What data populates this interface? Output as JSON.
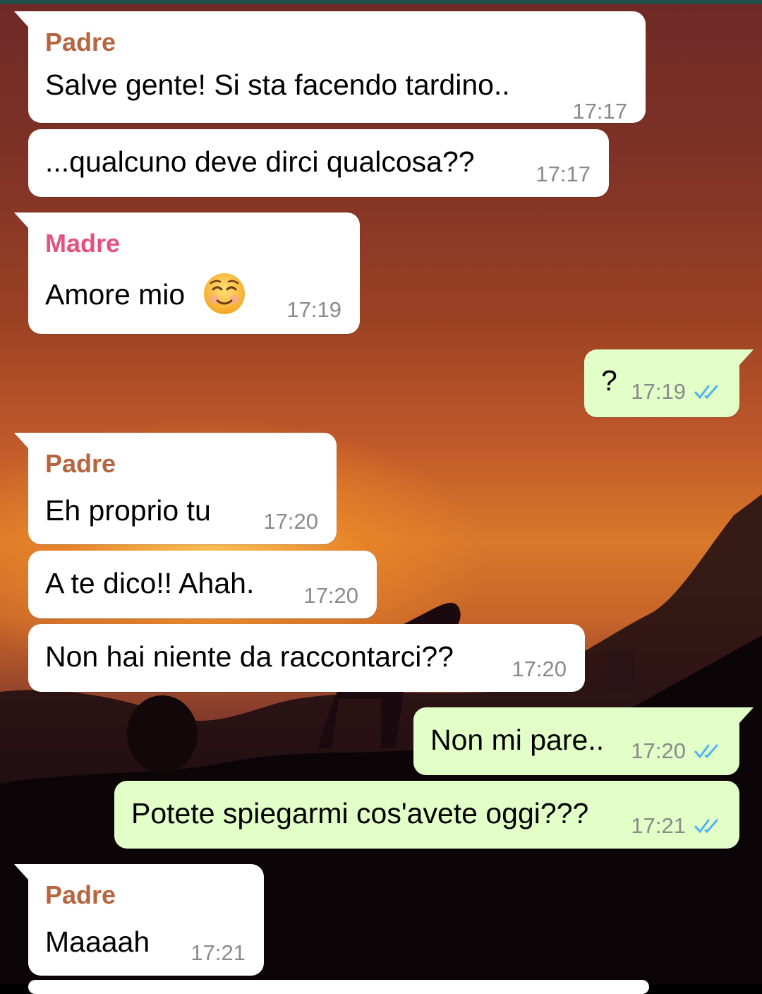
{
  "colors": {
    "incoming_bubble": "#ffffff",
    "outgoing_bubble": "#e1ffc7",
    "padre_name": "#b5653f",
    "madre_name": "#e5517f",
    "timestamp": "#8a8a8a",
    "read_ticks": "#4fb3f0"
  },
  "messages": [
    {
      "direction": "in",
      "sender": "Padre",
      "text": "Salve gente! Si sta facendo tardino..",
      "time": "17:17"
    },
    {
      "direction": "in",
      "sender": "",
      "text": "...qualcuno deve dirci qualcosa??",
      "time": "17:17"
    },
    {
      "direction": "in",
      "sender": "Madre",
      "text": "Amore mio",
      "emoji": "smiling-face-icon",
      "time": "17:19"
    },
    {
      "direction": "out",
      "text": "?",
      "time": "17:19",
      "status": "read-double-check-icon"
    },
    {
      "direction": "in",
      "sender": "Padre",
      "text": "Eh proprio tu",
      "time": "17:20"
    },
    {
      "direction": "in",
      "sender": "",
      "text": "A te dico!! Ahah.",
      "time": "17:20"
    },
    {
      "direction": "in",
      "sender": "",
      "text": "Non hai niente da raccontarci??",
      "time": "17:20"
    },
    {
      "direction": "out",
      "text": "Non mi pare..",
      "time": "17:20",
      "status": "read-double-check-icon"
    },
    {
      "direction": "out",
      "text": "Potete spiegarmi cos'avete oggi???",
      "time": "17:21",
      "status": "read-double-check-icon"
    },
    {
      "direction": "in",
      "sender": "Padre",
      "text": "Maaaah",
      "time": "17:21"
    }
  ]
}
